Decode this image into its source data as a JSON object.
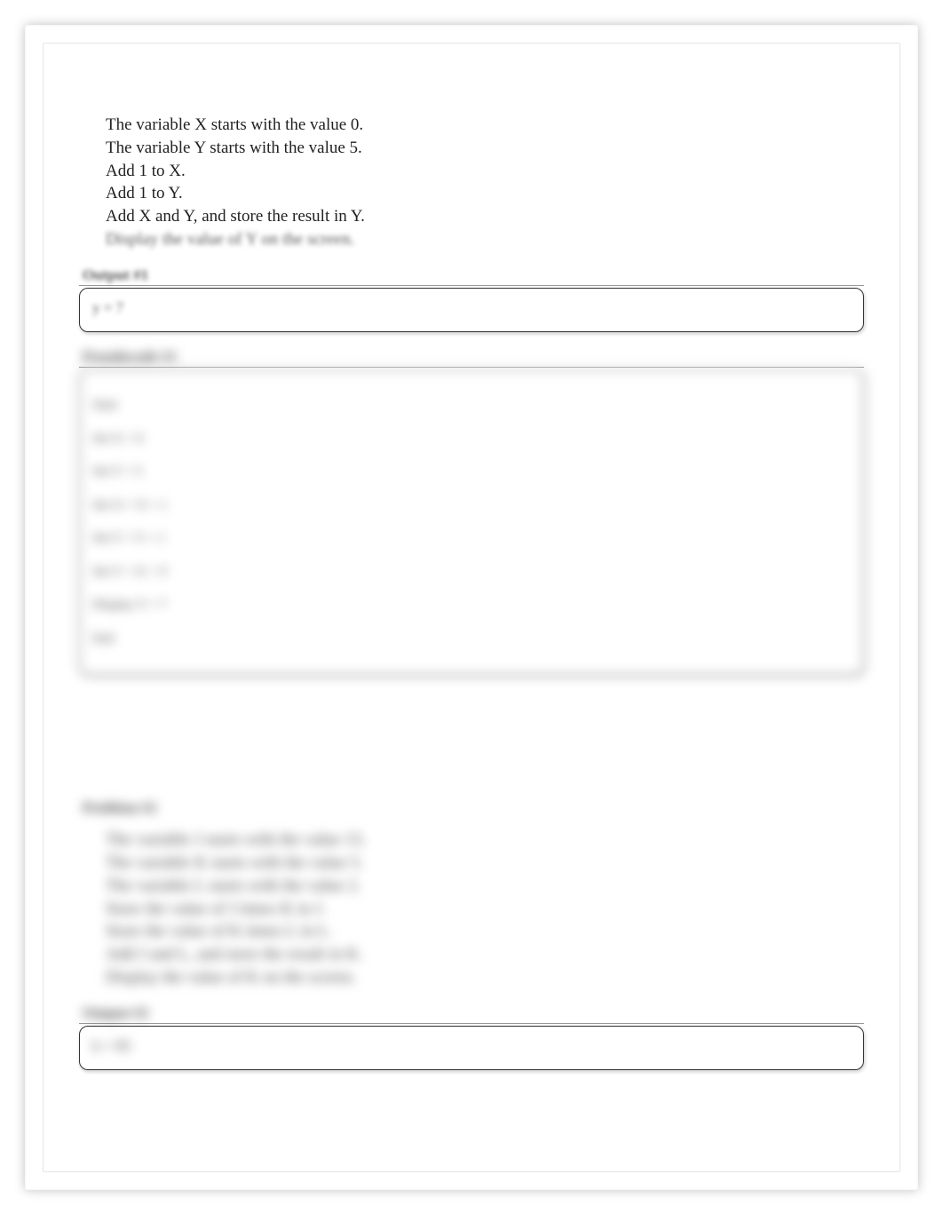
{
  "problem1": {
    "instructions": [
      "The variable X starts with the value 0.",
      "The variable Y starts with the value 5.",
      "Add 1 to X.",
      "Add 1 to Y.",
      "Add X and Y, and store the result in Y.",
      "Display the value of Y on the screen."
    ],
    "output_label": "Output #1",
    "output_value": "y = 7",
    "pseudocode_label": "Pseudocode #1",
    "pseudocode_lines": [
      "Start",
      "Set X = 0",
      "Set Y = 5",
      "Set X = X + 1",
      "Set Y = Y + 1",
      "Set Y = X + Y",
      "Display Y = 7",
      "End"
    ]
  },
  "problem2": {
    "heading": "Problem #2",
    "instructions": [
      "The variable J starts with the value 15.",
      "The variable K starts with the value 5.",
      "The variable L starts with the value 2.",
      "Store the value of J times K in J.",
      "Store the value of K times L in L.",
      "Add J and L, and store the result in K.",
      "Display the value of K on the screen."
    ],
    "output_label": "Output #2",
    "output_value": "k = 85"
  }
}
